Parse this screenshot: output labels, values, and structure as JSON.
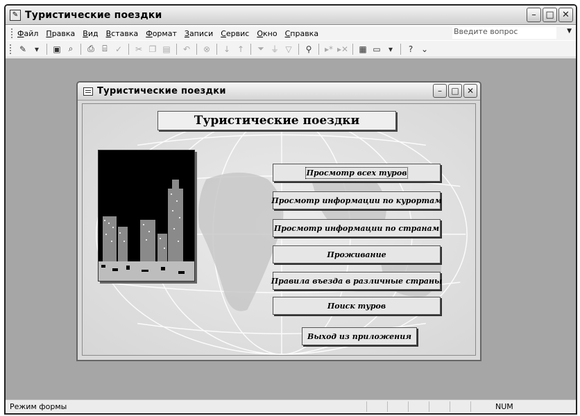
{
  "app": {
    "title": "Туристические поездки",
    "question_placeholder": "Введите вопрос"
  },
  "menu": [
    "Файл",
    "Правка",
    "Вид",
    "Вставка",
    "Формат",
    "Записи",
    "Сервис",
    "Окно",
    "Справка"
  ],
  "toolbar_icons": [
    "design-view-icon",
    "save-icon",
    "search-file-icon",
    "print-icon",
    "print-preview-icon",
    "spelling-icon",
    "cut-icon",
    "copy-icon",
    "paste-icon",
    "undo-icon",
    "hyperlink-icon",
    "sort-ascending-icon",
    "sort-descending-icon",
    "filter-by-selection-icon",
    "filter-by-form-icon",
    "apply-filter-icon",
    "find-icon",
    "new-record-icon",
    "delete-record-icon",
    "database-window-icon",
    "new-object-icon",
    "help-icon"
  ],
  "form": {
    "window_title": "Туристические  поездки",
    "header": "Туристические поездки",
    "buttons": [
      "Просмотр всех туров",
      "Просмотр информации по курортам",
      "Просмотр информации по странам",
      "Проживание",
      "Правила въезда в различные страны",
      "Поиск туров",
      "Выход из приложения"
    ]
  },
  "status": {
    "mode": "Режим формы",
    "num": "NUM"
  }
}
